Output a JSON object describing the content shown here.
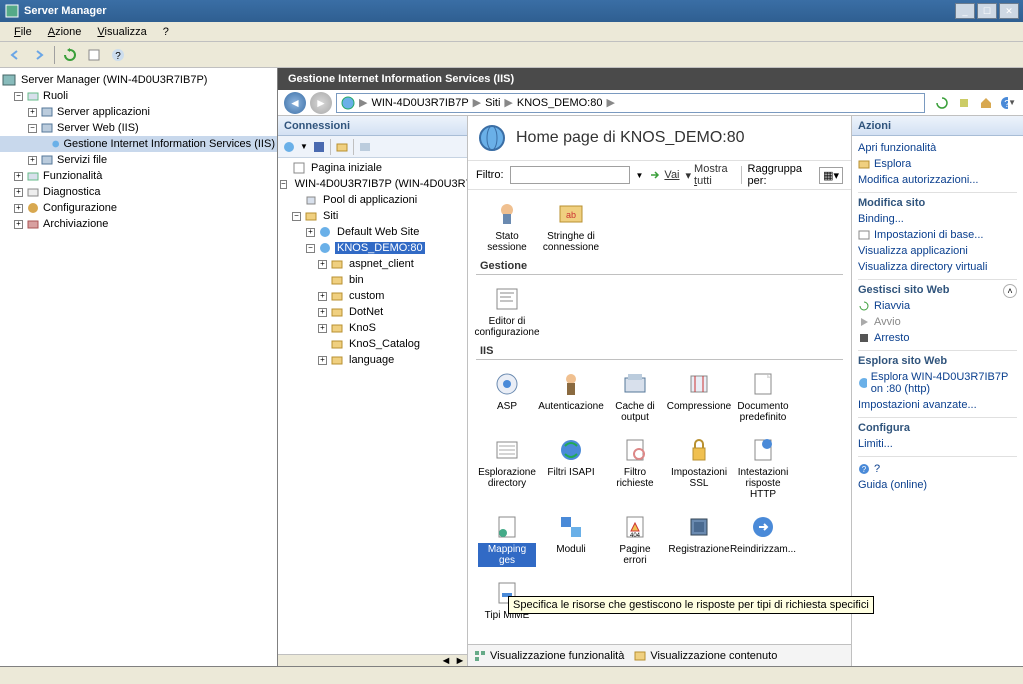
{
  "window": {
    "title": "Server Manager",
    "min": "_",
    "max": "☐",
    "close": "✕"
  },
  "menu": {
    "file": "File",
    "action": "Azione",
    "view": "Visualizza",
    "help": "?"
  },
  "leftTree": {
    "root": "Server Manager (WIN-4D0U3R7IB7P)",
    "roles": "Ruoli",
    "appServer": "Server applicazioni",
    "webServer": "Server Web (IIS)",
    "iisMgr": "Gestione Internet Information Services (IIS)",
    "svcFile": "Servizi file",
    "features": "Funzionalità",
    "diag": "Diagnostica",
    "config": "Configurazione",
    "arch": "Archiviazione"
  },
  "iis": {
    "title": "Gestione Internet Information Services (IIS)",
    "bc": {
      "server": "WIN-4D0U3R7IB7P",
      "sites": "Siti",
      "site": "KNOS_DEMO:80"
    }
  },
  "conn": {
    "header": "Connessioni",
    "start": "Pagina iniziale",
    "server": "WIN-4D0U3R7IB7P (WIN-4D0U3R7IB7P)",
    "appPools": "Pool di applicazioni",
    "sites": "Siti",
    "dws": "Default Web Site",
    "knos": "KNOS_DEMO:80",
    "folders": [
      "aspnet_client",
      "bin",
      "custom",
      "DotNet",
      "KnoS",
      "KnoS_Catalog",
      "language"
    ]
  },
  "center": {
    "title": "Home page di KNOS_DEMO:80",
    "filterLabel": "Filtro:",
    "go": "Vai",
    "showAll": "Mostra tutti",
    "groupBy": "Raggruppa per:",
    "sectTop": [
      "Stato sessione",
      "Stringhe di connessione"
    ],
    "sectMgmt": "Gestione",
    "mgmtItems": [
      "Editor di configurazione"
    ],
    "sectIIS": "IIS",
    "iisRow1": [
      "ASP",
      "Autenticazione",
      "Cache di output",
      "Compressione",
      "Documento predefinito"
    ],
    "iisRow2": [
      "Esplorazione directory",
      "Filtri ISAPI",
      "Filtro richieste",
      "Impostazioni SSL",
      "Intestazioni risposte HTTP"
    ],
    "iisRow3": [
      "Mapping ges",
      "Moduli",
      "Pagine errori",
      "Registrazione",
      "Reindirizzam..."
    ],
    "iisRow4": [
      "Tipi MIME"
    ],
    "tooltip": "Specifica le risorse che gestiscono le risposte per tipi di richiesta specifici",
    "tabFeat": "Visualizzazione funzionalità",
    "tabCont": "Visualizzazione contenuto"
  },
  "actions": {
    "header": "Azioni",
    "openFeature": "Apri funzionalità",
    "explore": "Esplora",
    "editPerm": "Modifica autorizzazioni...",
    "editSite": "Modifica sito",
    "binding": "Binding...",
    "basic": "Impostazioni di base...",
    "viewApps": "Visualizza applicazioni",
    "viewVDir": "Visualizza directory virtuali",
    "manageSite": "Gestisci sito Web",
    "restart": "Riavvia",
    "start": "Avvio",
    "stop": "Arresto",
    "browseSite": "Esplora sito Web",
    "browseLink": "Esplora WIN-4D0U3R7IB7P on :80 (http)",
    "adv": "Impostazioni avanzate...",
    "configure": "Configura",
    "limits": "Limiti...",
    "helpIcon": "?",
    "helpOnline": "Guida (online)"
  }
}
